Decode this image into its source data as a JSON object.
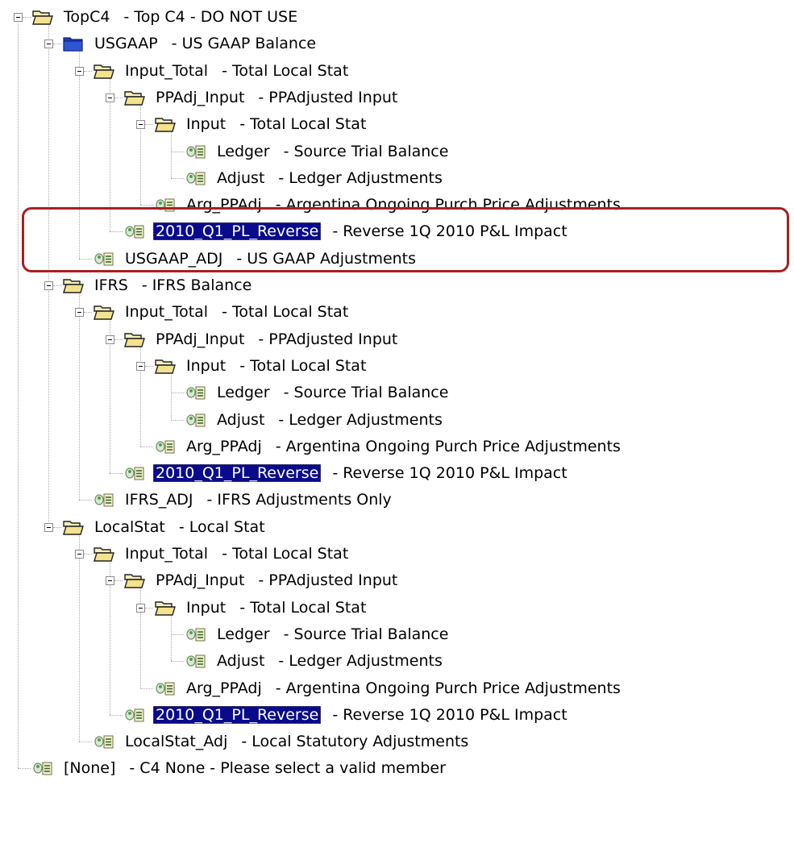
{
  "tree": [
    {
      "depth": 0,
      "icon": "folder-open-icon",
      "expandable": true,
      "name": "TopC4",
      "desc": "- Top C4 - DO NOT USE",
      "selected": false
    },
    {
      "depth": 1,
      "icon": "folder-blue-icon",
      "expandable": true,
      "name": "USGAAP",
      "desc": "- US GAAP Balance",
      "selected": false
    },
    {
      "depth": 2,
      "icon": "folder-open-icon",
      "expandable": true,
      "name": "Input_Total",
      "desc": "- Total Local Stat",
      "selected": false
    },
    {
      "depth": 3,
      "icon": "folder-open-icon",
      "expandable": true,
      "name": "PPAdj_Input",
      "desc": "- PPAdjusted Input",
      "selected": false
    },
    {
      "depth": 4,
      "icon": "folder-open-icon",
      "expandable": true,
      "name": "Input",
      "desc": "- Total Local Stat",
      "selected": false
    },
    {
      "depth": 5,
      "icon": "member-icon",
      "expandable": false,
      "name": "Ledger",
      "desc": "- Source Trial Balance",
      "selected": false
    },
    {
      "depth": 5,
      "icon": "member-icon",
      "expandable": false,
      "name": "Adjust",
      "desc": "- Ledger Adjustments",
      "selected": false
    },
    {
      "depth": 4,
      "icon": "member-icon",
      "expandable": false,
      "name": "Arg_PPAdj",
      "desc": "- Argentina Ongoing Purch Price Adjustments",
      "selected": false
    },
    {
      "depth": 3,
      "icon": "member-icon",
      "expandable": false,
      "name": "2010_Q1_PL_Reverse",
      "desc": "- Reverse 1Q 2010 P&L Impact",
      "selected": true
    },
    {
      "depth": 2,
      "icon": "member-icon",
      "expandable": false,
      "name": "USGAAP_ADJ",
      "desc": "- US GAAP Adjustments",
      "selected": false
    },
    {
      "depth": 1,
      "icon": "folder-open-icon",
      "expandable": true,
      "name": "IFRS",
      "desc": "- IFRS Balance",
      "selected": false
    },
    {
      "depth": 2,
      "icon": "folder-open-icon",
      "expandable": true,
      "name": "Input_Total",
      "desc": "- Total Local Stat",
      "selected": false
    },
    {
      "depth": 3,
      "icon": "folder-open-icon",
      "expandable": true,
      "name": "PPAdj_Input",
      "desc": "- PPAdjusted Input",
      "selected": false
    },
    {
      "depth": 4,
      "icon": "folder-open-icon",
      "expandable": true,
      "name": "Input",
      "desc": "- Total Local Stat",
      "selected": false
    },
    {
      "depth": 5,
      "icon": "member-icon",
      "expandable": false,
      "name": "Ledger",
      "desc": "- Source Trial Balance",
      "selected": false
    },
    {
      "depth": 5,
      "icon": "member-icon",
      "expandable": false,
      "name": "Adjust",
      "desc": "- Ledger Adjustments",
      "selected": false
    },
    {
      "depth": 4,
      "icon": "member-icon",
      "expandable": false,
      "name": "Arg_PPAdj",
      "desc": "- Argentina Ongoing Purch Price Adjustments",
      "selected": false
    },
    {
      "depth": 3,
      "icon": "member-icon",
      "expandable": false,
      "name": "2010_Q1_PL_Reverse",
      "desc": "- Reverse 1Q 2010 P&L Impact",
      "selected": true
    },
    {
      "depth": 2,
      "icon": "member-icon",
      "expandable": false,
      "name": "IFRS_ADJ",
      "desc": "- IFRS Adjustments Only",
      "selected": false
    },
    {
      "depth": 1,
      "icon": "folder-open-icon",
      "expandable": true,
      "name": "LocalStat",
      "desc": "- Local Stat",
      "selected": false
    },
    {
      "depth": 2,
      "icon": "folder-open-icon",
      "expandable": true,
      "name": "Input_Total",
      "desc": "- Total Local Stat",
      "selected": false
    },
    {
      "depth": 3,
      "icon": "folder-open-icon",
      "expandable": true,
      "name": "PPAdj_Input",
      "desc": "- PPAdjusted Input",
      "selected": false
    },
    {
      "depth": 4,
      "icon": "folder-open-icon",
      "expandable": true,
      "name": "Input",
      "desc": "- Total Local Stat",
      "selected": false
    },
    {
      "depth": 5,
      "icon": "member-icon",
      "expandable": false,
      "name": "Ledger",
      "desc": "- Source Trial Balance",
      "selected": false
    },
    {
      "depth": 5,
      "icon": "member-icon",
      "expandable": false,
      "name": "Adjust",
      "desc": "- Ledger Adjustments",
      "selected": false
    },
    {
      "depth": 4,
      "icon": "member-icon",
      "expandable": false,
      "name": "Arg_PPAdj",
      "desc": "- Argentina Ongoing Purch Price Adjustments",
      "selected": false
    },
    {
      "depth": 3,
      "icon": "member-icon",
      "expandable": false,
      "name": "2010_Q1_PL_Reverse",
      "desc": "- Reverse 1Q 2010 P&L Impact",
      "selected": true
    },
    {
      "depth": 2,
      "icon": "member-icon",
      "expandable": false,
      "name": "LocalStat_Adj",
      "desc": "- Local Statutory Adjustments",
      "selected": false
    },
    {
      "depth": 0,
      "icon": "member-icon",
      "expandable": false,
      "name": "[None]",
      "desc": "- C4 None - Please select a valid member",
      "selected": false
    }
  ],
  "colors": {
    "selection_bg": "#0a0a8c",
    "selection_fg": "#ffffff",
    "folder_yellow": "#f4e28c",
    "folder_blue": "#1d3fb4",
    "annotation_red": "#a91f22"
  }
}
